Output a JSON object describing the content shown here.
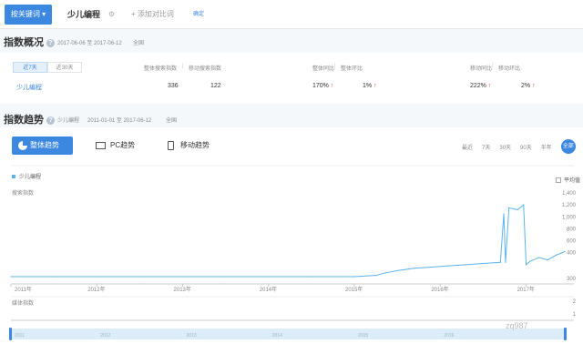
{
  "search": {
    "type_button": "按关键词 ▾",
    "keyword": "少儿编程",
    "add_compare": "+ 添加对比词",
    "confirm": "确定"
  },
  "overview": {
    "title": "指数概况",
    "date_range": "2017-06-06 至 2017-06-12",
    "region": "全国",
    "tabs": [
      "近7天",
      "近30天"
    ],
    "headers": {
      "overall_search": "整体搜索指数",
      "mobile_search": "移动搜索指数",
      "overall_yoy": "整体同比",
      "overall_mom": "整体环比",
      "mobile_yoy": "移动同比",
      "mobile_mom": "移动环比"
    },
    "keyword": "少儿编程",
    "values": {
      "overall_search": "336",
      "mobile_search": "122",
      "overall_yoy": "170%",
      "overall_mom": "1%",
      "mobile_yoy": "222%",
      "mobile_mom": "2%"
    },
    "colors": {
      "up_arrow": "#e8542a"
    }
  },
  "trend": {
    "title": "指数趋势",
    "keyword": "少儿编程",
    "date_range": "2011-01-01 至 2017-06-12",
    "region": "全国",
    "tabs": [
      "整体趋势",
      "PC趋势",
      "移动趋势"
    ],
    "periods": [
      "最近",
      "7天",
      "30天",
      "90天",
      "半年",
      "全部"
    ],
    "legend": "少儿编程",
    "average_toggle": "平均值",
    "y_axis_name": "搜索指数",
    "media_axis_name": "媒体指数",
    "icons": [
      "pie-icon",
      "monitor-icon",
      "mobile-icon"
    ]
  },
  "chart_data": {
    "type": "line",
    "series": [
      {
        "name": "少儿编程",
        "x": [
          2011.0,
          2011.5,
          2012.0,
          2012.5,
          2013.0,
          2013.5,
          2014.0,
          2014.5,
          2015.0,
          2015.25,
          2015.35,
          2015.5,
          2015.7,
          2015.9,
          2016.1,
          2016.3,
          2016.5,
          2016.7,
          2016.74,
          2016.76,
          2016.8,
          2016.9,
          2016.97,
          2017.0,
          2017.05,
          2017.15,
          2017.25,
          2017.35,
          2017.45
        ],
        "values": [
          0,
          0,
          0,
          0,
          0,
          0,
          0,
          0,
          0,
          20,
          60,
          100,
          140,
          160,
          180,
          200,
          220,
          240,
          1050,
          240,
          1150,
          1120,
          1200,
          200,
          260,
          320,
          280,
          360,
          420
        ]
      }
    ],
    "x_ticks": [
      "2011年",
      "2012年",
      "2013年",
      "2014年",
      "2015年",
      "2016年",
      "2017年"
    ],
    "y_ticks": [
      "1,400",
      "1,200",
      "1,000",
      "800",
      "600",
      "400",
      "300"
    ],
    "ylim": [
      0,
      1400
    ],
    "ylabel": "搜索指数",
    "media_ticks": [
      "2",
      "1"
    ],
    "slider_labels": [
      "2011",
      "2012",
      "2013",
      "2014",
      "2015",
      "2016"
    ],
    "colors": {
      "line": "#5ab4ef",
      "slider": "#dcecf9",
      "handle": "#3c87e0"
    }
  },
  "watermark": "zq987"
}
